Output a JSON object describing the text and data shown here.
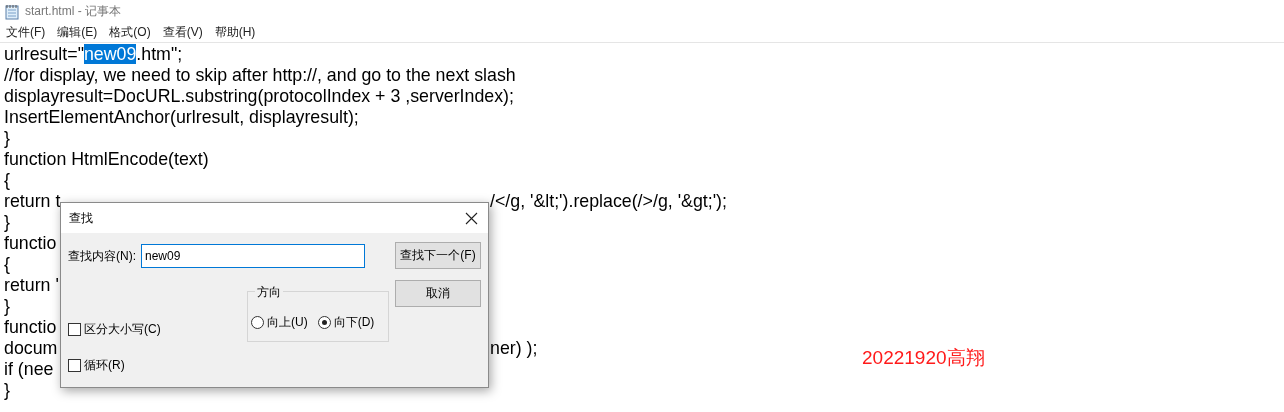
{
  "window": {
    "title": "start.html - 记事本"
  },
  "menu": [
    {
      "label": "文件(F)"
    },
    {
      "label": "编辑(E)"
    },
    {
      "label": "格式(O)"
    },
    {
      "label": "查看(V)"
    },
    {
      "label": "帮助(H)"
    }
  ],
  "editor": {
    "lines": [
      {
        "parts": [
          {
            "text": "urlresult=\"",
            "selected": false
          },
          {
            "text": "new09",
            "selected": true
          },
          {
            "text": ".htm\";",
            "selected": false
          }
        ]
      },
      {
        "text": "//for display, we need to skip after http://, and go to the next slash"
      },
      {
        "text": "displayresult=DocURL.substring(protocolIndex + 3 ,serverIndex);"
      },
      {
        "text": "InsertElementAnchor(urlresult, displayresult);"
      },
      {
        "text": "}"
      },
      {
        "text": "function HtmlEncode(text)"
      },
      {
        "text": "{"
      },
      {
        "text": "return t",
        "after_dialog": "/</g, '&lt;').replace(/>/g, '&gt;');"
      },
      {
        "text": "}"
      },
      {
        "text": "functio"
      },
      {
        "text": "{"
      },
      {
        "text": "return '"
      },
      {
        "text": "}"
      },
      {
        "text": "functio"
      },
      {
        "text": "docum",
        "after_dialog": "ner) );"
      },
      {
        "text": "if (nee"
      },
      {
        "text": "}"
      }
    ],
    "annotation": "20221920高翔"
  },
  "find_dialog": {
    "title": "查找",
    "search_label": "查找内容(N):",
    "search_value": "new09",
    "buttons": [
      {
        "label": "查找下一个(F)"
      },
      {
        "label": "取消"
      }
    ],
    "direction": {
      "label": "方向",
      "options": [
        {
          "label": "向上(U)",
          "selected": false
        },
        {
          "label": "向下(D)",
          "selected": true
        }
      ]
    },
    "options": [
      {
        "label": "区分大小写(C)",
        "checked": false
      },
      {
        "label": "循环(R)",
        "checked": false
      }
    ]
  }
}
